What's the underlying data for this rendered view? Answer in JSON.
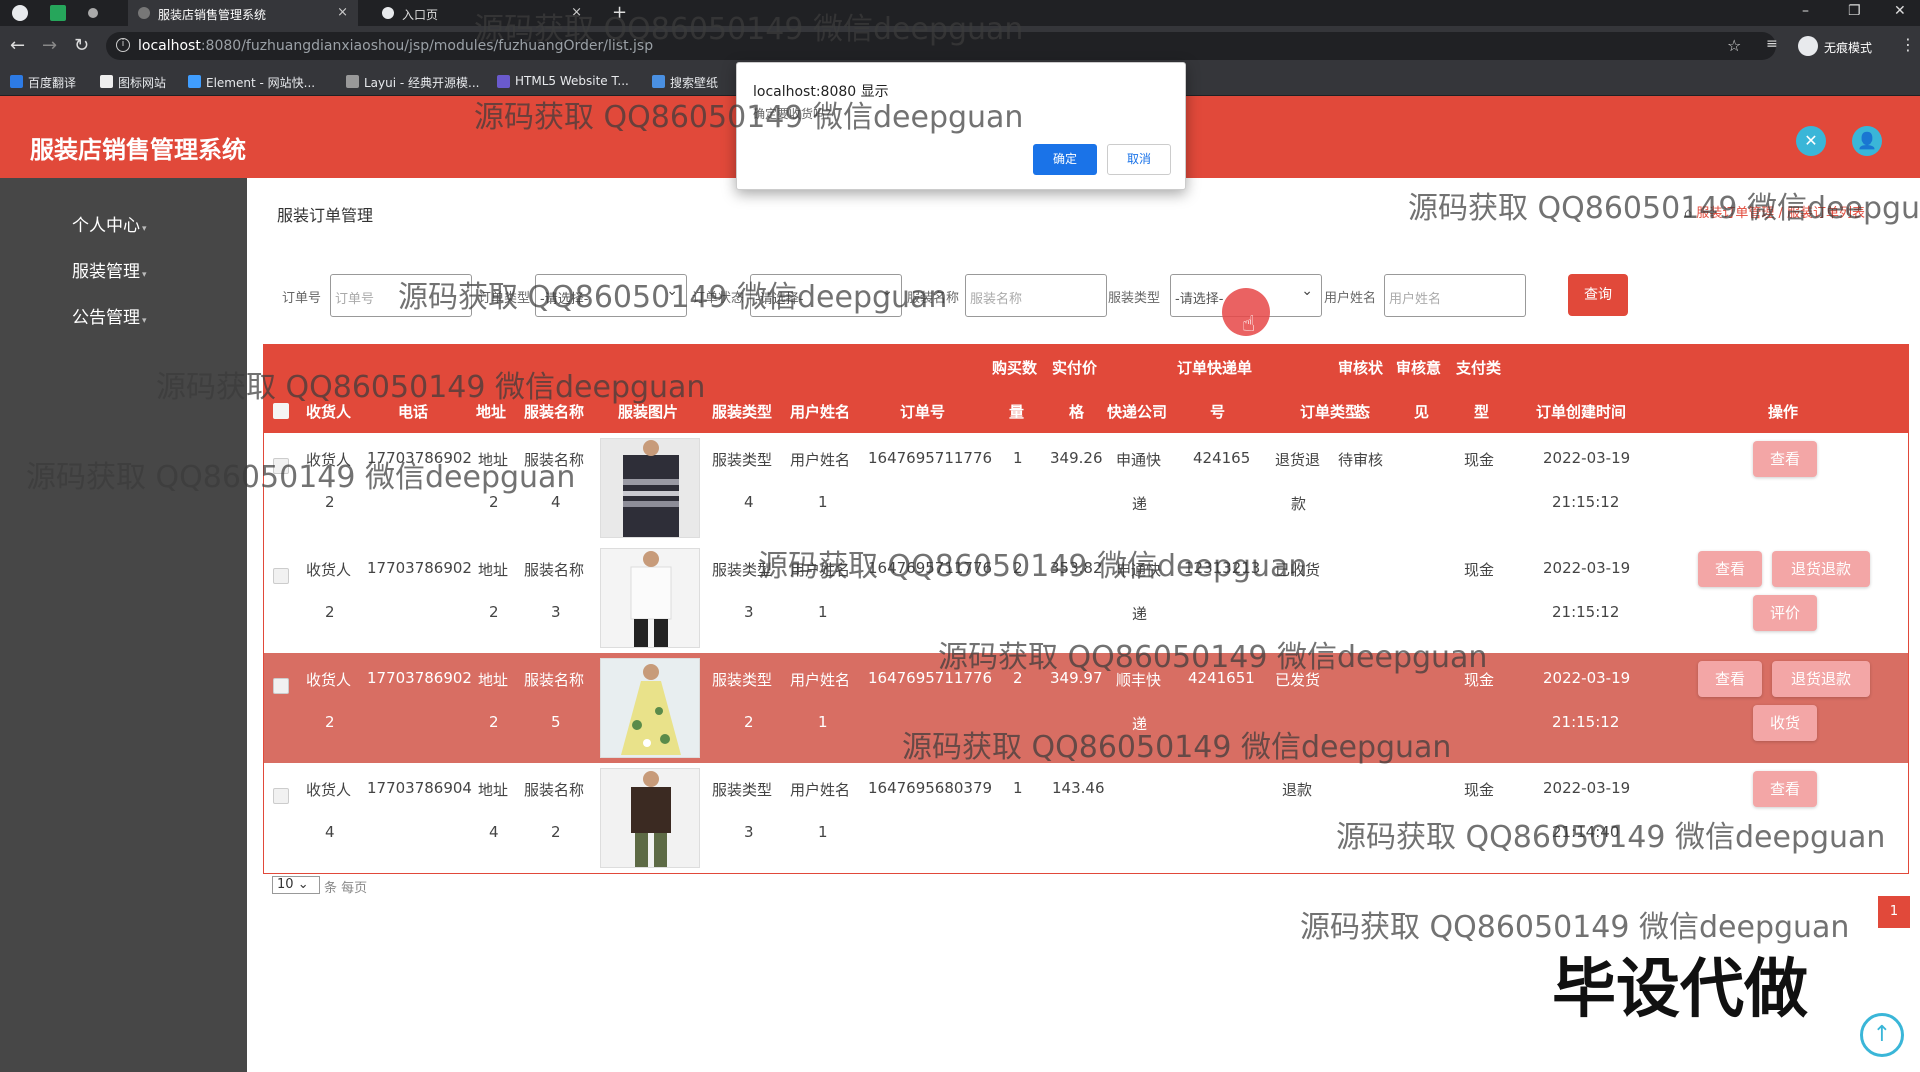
{
  "browser": {
    "tabs": [
      {
        "title": "服装店销售管理系统",
        "close": "×"
      },
      {
        "title": "入口页",
        "close": "×"
      }
    ],
    "new_tab": "+",
    "window_controls": {
      "minimize": "–",
      "maximize": "❐",
      "close": "✕"
    },
    "nav": {
      "back": "←",
      "forward": "→",
      "reload": "↻"
    },
    "url_host": "localhost",
    "url_path": ":8080/fuzhuangdianxiaoshou/jsp/modules/fuzhuangOrder/list.jsp",
    "incognito_label": "无痕模式",
    "bookmarks": [
      "百度翻译",
      "图标网站",
      "Element - 网站快...",
      "Layui - 经典开源模...",
      "HTML5 Website T...",
      "搜索壁纸"
    ]
  },
  "dialog": {
    "title": "localhost:8080 显示",
    "message": "确定要收货吗?",
    "ok_label": "确定",
    "cancel_label": "取消"
  },
  "header": {
    "app_title": "服装店销售管理系统",
    "icon_left": "tools-icon",
    "icon_right": "user-icon"
  },
  "sidebar": {
    "items": [
      {
        "label": "个人中心"
      },
      {
        "label": "服装管理"
      },
      {
        "label": "公告管理"
      }
    ]
  },
  "main": {
    "page_title": "服装订单管理",
    "breadcrumb": {
      "home": "⌂",
      "trail": "服装订单管理 / 服装订单列表"
    },
    "filters": {
      "order_no_label": "订单号",
      "order_no_placeholder": "订单号",
      "type_label": "订单类型",
      "type_value": "-请选择-",
      "status_label": "订单状态",
      "status_value": "-请选择-",
      "name_label": "服装名称",
      "name_placeholder": "服装名称",
      "clothes_type_label": "服装类型",
      "clothes_type_value": "-请选择-",
      "user_label": "用户姓名",
      "user_placeholder": "用户姓名",
      "search_label": "查询"
    },
    "table": {
      "headers": {
        "receiver": "收货人",
        "phone": "电话",
        "address": "地址",
        "clothes_name": "服装名称",
        "photo": "服装图片",
        "clothes_type": "服装类型",
        "user_name": "用户姓名",
        "order_no": "订单号",
        "qty_top": "购买数",
        "qty_bottom": "量",
        "price_top": "实付价",
        "price_bottom": "格",
        "courier": "快递公司",
        "track_top": "订单快递单",
        "track_bottom": "号",
        "order_type": "订单类型",
        "audit_top": "审核状",
        "audit_bottom": "态",
        "opinion_top": "审核意",
        "opinion_bottom": "见",
        "pay_top": "支付类",
        "pay_bottom": "型",
        "created": "订单创建时间",
        "ops": "操作"
      },
      "rows": [
        {
          "receiver1": "收货人",
          "receiver2": "2",
          "phone": "17703786902",
          "addr1": "地址",
          "addr2": "2",
          "name1": "服装名称",
          "name2": "4",
          "type1": "服装类型",
          "type2": "4",
          "user1": "用户姓名",
          "user2": "1",
          "order_no": "1647695711776",
          "qty": "1",
          "price": "349.26",
          "courier1": "申通快",
          "courier2": "递",
          "track": "424165",
          "otype1": "退货退",
          "otype2": "款",
          "audit": "待审核",
          "pay": "现金",
          "date": "2022-03-19",
          "time": "21:15:12",
          "btn_view": "查看"
        },
        {
          "receiver1": "收货人",
          "receiver2": "2",
          "phone": "17703786902",
          "addr1": "地址",
          "addr2": "2",
          "name1": "服装名称",
          "name2": "3",
          "type1": "服装类型",
          "type2": "3",
          "user1": "用户姓名",
          "user2": "1",
          "order_no": "1647695711776",
          "qty": "2",
          "price": "353.82",
          "courier1": "申通快",
          "courier2": "递",
          "track": "12313213",
          "otype1": "已收货",
          "pay": "现金",
          "date": "2022-03-19",
          "time": "21:15:12",
          "btn_view": "查看",
          "btn_refund": "退货退款",
          "btn_review": "评价"
        },
        {
          "receiver1": "收货人",
          "receiver2": "2",
          "phone": "17703786902",
          "addr1": "地址",
          "addr2": "2",
          "name1": "服装名称",
          "name2": "5",
          "type1": "服装类型",
          "type2": "2",
          "user1": "用户姓名",
          "user2": "1",
          "order_no": "1647695711776",
          "qty": "2",
          "price": "349.97",
          "courier1": "顺丰快",
          "courier2": "递",
          "track": "4241651",
          "otype1": "已发货",
          "pay": "现金",
          "date": "2022-03-19",
          "time": "21:15:12",
          "btn_view": "查看",
          "btn_refund": "退货退款",
          "btn_receive": "收货"
        },
        {
          "receiver1": "收货人",
          "receiver2": "4",
          "phone": "17703786904",
          "addr1": "地址",
          "addr2": "4",
          "name1": "服装名称",
          "name2": "2",
          "type1": "服装类型",
          "type2": "3",
          "user1": "用户姓名",
          "user2": "1",
          "order_no": "1647695680379",
          "qty": "1",
          "price": "143.46",
          "otype1": "退款",
          "pay": "现金",
          "date": "2022-03-19",
          "time": "21:14:40",
          "btn_view": "查看"
        }
      ]
    },
    "pagination": {
      "page_size": "10",
      "page_size_suffix": "条 每页",
      "current_page": "1"
    }
  },
  "overlays": {
    "watermark": "源码获取 QQ86050149 微信deepguan",
    "watermark_big": "毕设代做",
    "back_to_top": "↑"
  },
  "colors": {
    "brand": "#e1493a",
    "sidebar": "#474747",
    "accent": "#3ab6d8",
    "row_highlight": "#d86e63",
    "op_button": "#f3a6a6"
  }
}
